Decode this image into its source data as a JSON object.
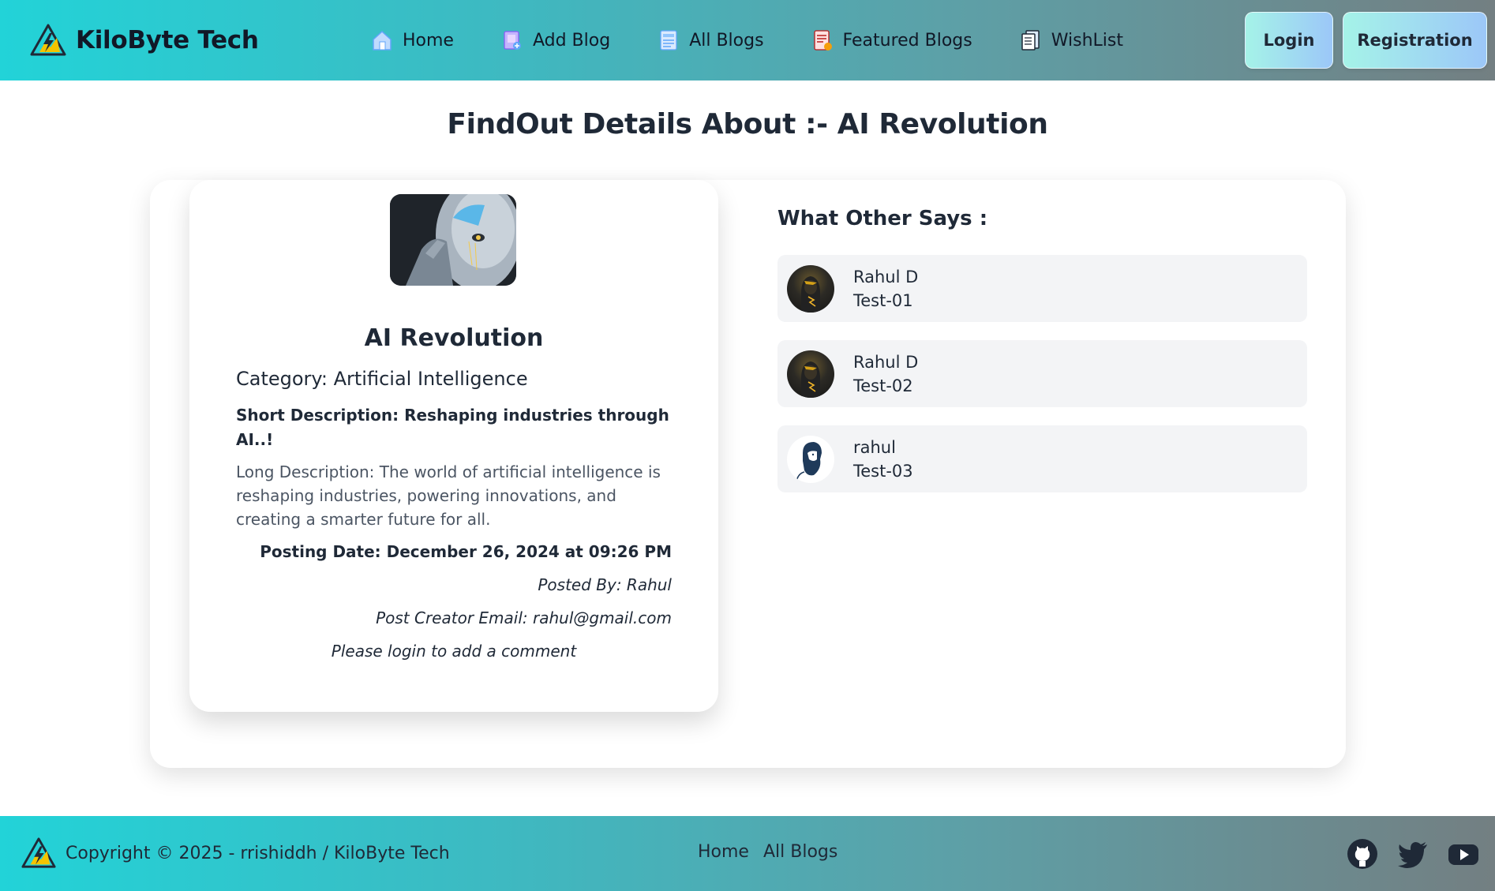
{
  "nav": {
    "brand": "KiloByte Tech",
    "links": [
      {
        "label": "Home",
        "icon": "home-icon"
      },
      {
        "label": "Add Blog",
        "icon": "add-blog-icon"
      },
      {
        "label": "All Blogs",
        "icon": "all-blogs-icon"
      },
      {
        "label": "Featured Blogs",
        "icon": "featured-blogs-icon"
      },
      {
        "label": "WishList",
        "icon": "wishlist-icon"
      }
    ],
    "login_label": "Login",
    "register_label": "Registration"
  },
  "page": {
    "title": "FindOut Details About :- AI Revolution"
  },
  "blog": {
    "title": "AI Revolution",
    "category": "Category: Artificial Intelligence",
    "short_description": "Short Description: Reshaping industries through AI..!",
    "long_description": "Long Description: The world of artificial intelligence is reshaping industries, powering innovations, and creating a smarter future for all.",
    "posting_date": "Posting Date: December 26, 2024 at 09:26 PM",
    "posted_by": "Posted By: Rahul",
    "creator_email": "Post Creator Email: rahul@gmail.com",
    "login_note": "Please login to add a comment"
  },
  "comments": {
    "title": "What Other Says :",
    "items": [
      {
        "name": "Rahul D",
        "text": "Test-01",
        "avatar": "dark-hooded-figure"
      },
      {
        "name": "Rahul D",
        "text": "Test-02",
        "avatar": "dark-hooded-figure"
      },
      {
        "name": "rahul",
        "text": "Test-03",
        "avatar": "bearded-man-silhouette"
      }
    ]
  },
  "footer": {
    "copyright": "Copyright © 2025 - rrishiddh / KiloByte Tech",
    "links": [
      "Home",
      "All Blogs"
    ],
    "socials": [
      "github-icon",
      "twitter-icon",
      "youtube-icon"
    ]
  },
  "colors": {
    "gradient_start": "#22d3d8",
    "gradient_end": "#737f82",
    "button_start": "#a5f3e8",
    "button_end": "#9cc7f8",
    "comment_bg": "#f3f4f6"
  }
}
